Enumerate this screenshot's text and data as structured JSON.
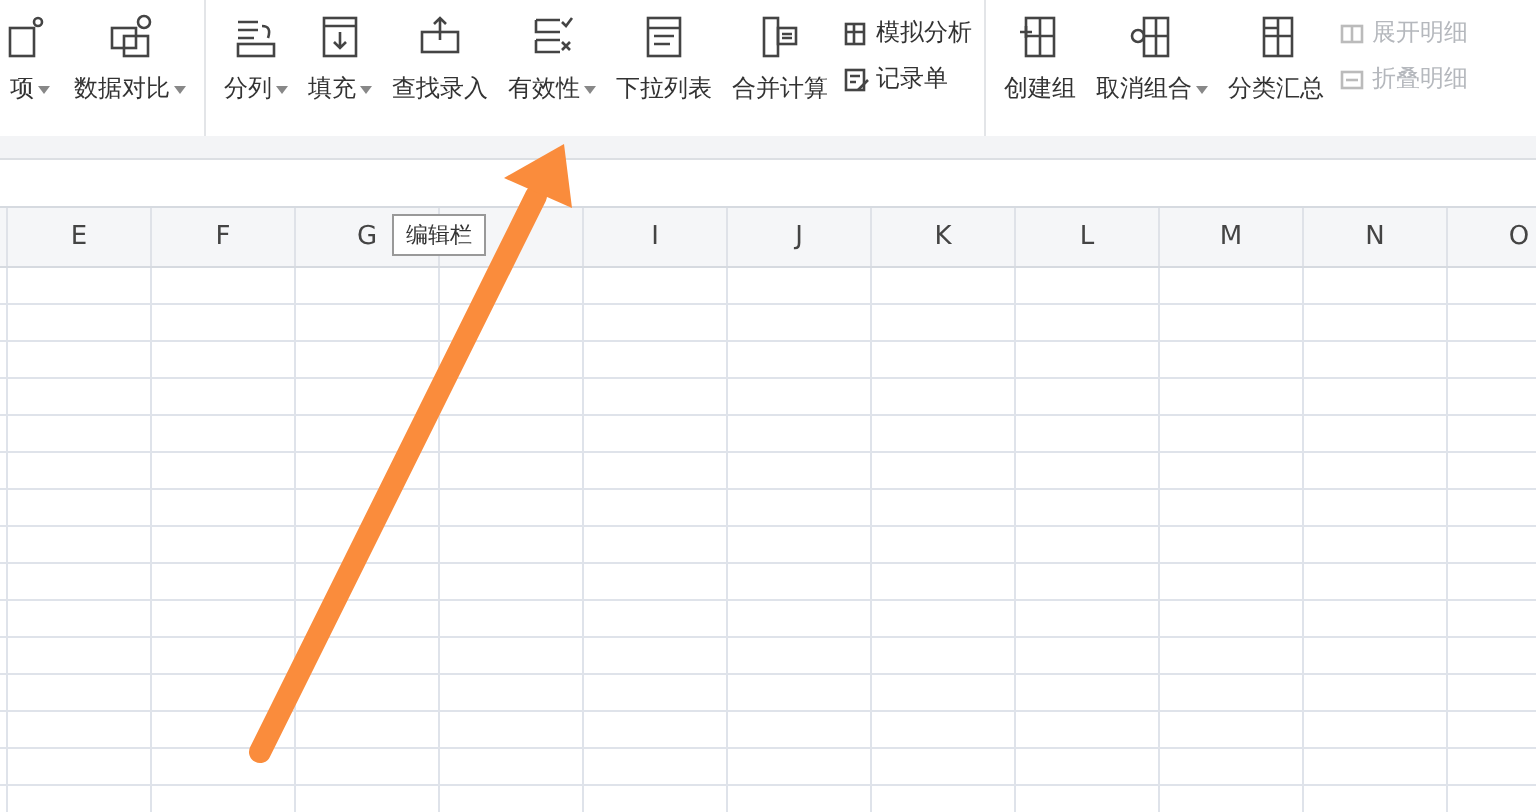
{
  "toolbar": {
    "groups": [
      {
        "items": [
          {
            "kind": "large",
            "label": "项",
            "dropdown": true
          },
          {
            "kind": "large",
            "label": "数据对比",
            "dropdown": true
          }
        ]
      },
      {
        "items": [
          {
            "kind": "large",
            "label": "分列",
            "dropdown": true
          },
          {
            "kind": "large",
            "label": "填充",
            "dropdown": true
          },
          {
            "kind": "large",
            "label": "查找录入",
            "dropdown": false
          },
          {
            "kind": "large",
            "label": "有效性",
            "dropdown": true
          },
          {
            "kind": "large",
            "label": "下拉列表",
            "dropdown": false
          },
          {
            "kind": "large",
            "label": "合并计算",
            "dropdown": false
          },
          {
            "kind": "stack",
            "entries": [
              {
                "label": "模拟分析",
                "disabled": false
              },
              {
                "label": "记录单",
                "disabled": false
              }
            ]
          }
        ]
      },
      {
        "items": [
          {
            "kind": "large",
            "label": "创建组",
            "dropdown": false
          },
          {
            "kind": "large",
            "label": "取消组合",
            "dropdown": true
          },
          {
            "kind": "large",
            "label": "分类汇总",
            "dropdown": false
          },
          {
            "kind": "stack",
            "entries": [
              {
                "label": "展开明细",
                "disabled": true
              },
              {
                "label": "折叠明细",
                "disabled": true
              }
            ]
          }
        ]
      }
    ]
  },
  "sheet": {
    "columns": [
      {
        "kind": "label",
        "text": "E"
      },
      {
        "kind": "label",
        "text": "F"
      },
      {
        "kind": "label",
        "text": "G"
      },
      {
        "kind": "tooltip",
        "text": "编辑栏"
      },
      {
        "kind": "label",
        "text": "I"
      },
      {
        "kind": "label",
        "text": "J"
      },
      {
        "kind": "label",
        "text": "K"
      },
      {
        "kind": "label",
        "text": "L"
      },
      {
        "kind": "label",
        "text": "M"
      },
      {
        "kind": "label",
        "text": "N"
      },
      {
        "kind": "label",
        "text": "O"
      }
    ]
  }
}
